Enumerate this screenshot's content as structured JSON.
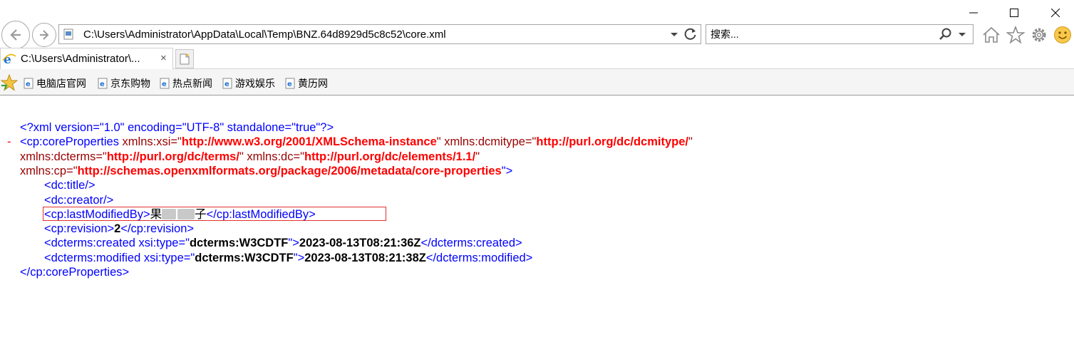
{
  "window": {
    "minimize_icon": "minimize-icon",
    "maximize_icon": "maximize-icon",
    "close_icon": "close-icon"
  },
  "toolbar": {
    "address": "C:\\Users\\Administrator\\AppData\\Local\\Temp\\BNZ.64d8929d5c8c52\\core.xml",
    "search_placeholder": "搜索...",
    "icons": [
      "back-icon",
      "forward-icon",
      "refresh-icon",
      "search-icon",
      "home-icon",
      "favorites-star-icon",
      "settings-gear-icon",
      "smiley-feedback-icon"
    ]
  },
  "tab": {
    "title": "C:\\Users\\Administrator\\...",
    "close": "×"
  },
  "favorites": {
    "items": [
      {
        "label": "电脑店官网"
      },
      {
        "label": "京东购物"
      },
      {
        "label": "热点新闻"
      },
      {
        "label": "游戏娱乐"
      },
      {
        "label": "黄历网"
      }
    ]
  },
  "xml": {
    "decl": "<?xml version=\"1.0\" encoding=\"UTF-8\" standalone=\"true\"?>",
    "collapse": "-",
    "root_open_tag": "<cp:coreProperties",
    "attr1_name": " xmlns:xsi=\"",
    "attr1_val": "http://www.w3.org/2001/XMLSchema-instance",
    "attr2_name": "\" xmlns:dcmitype=\"",
    "attr2_val": "http://purl.org/dc/dcmitype/",
    "quote": "\"",
    "attr3_name": "xmlns:dcterms=\"",
    "attr3_val": "http://purl.org/dc/terms/",
    "attr4_name": "\" xmlns:dc=\"",
    "attr4_val": "http://purl.org/dc/elements/1.1/",
    "attr5_name": "xmlns:cp=\"",
    "attr5_val": "http://schemas.openxmlformats.org/package/2006/metadata/core-properties",
    "close_gt": "\">",
    "title": "<dc:title/>",
    "creator": "<dc:creator/>",
    "lmb_open": "<cp:lastModifiedBy>",
    "lmb_value_start": "果",
    "lmb_value_end": "子",
    "lmb_close": "</cp:lastModifiedBy>",
    "rev_open": "<cp:revision>",
    "rev_value": "2",
    "rev_close": "</cp:revision>",
    "created_open": "<dcterms:created xsi:type=\"",
    "created_type": "dcterms:W3CDTF",
    "created_gt": "\">",
    "created_value": "2023-08-13T08:21:36Z",
    "created_close": "</dcterms:created>",
    "modified_open": "<dcterms:modified xsi:type=\"",
    "modified_type": "dcterms:W3CDTF",
    "modified_gt": "\">",
    "modified_value": "2023-08-13T08:21:38Z",
    "modified_close": "</dcterms:modified>",
    "root_close": "</cp:coreProperties>"
  },
  "colors": {
    "markup": "#0000ff",
    "element": "#990000",
    "value": "#ff0000",
    "highlight_box": "#e03030"
  }
}
